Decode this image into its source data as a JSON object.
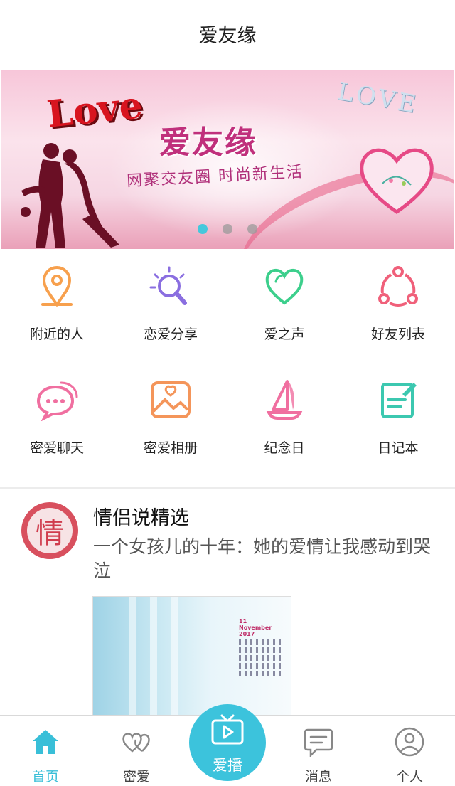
{
  "header": {
    "title": "爱友缘"
  },
  "banner": {
    "love_text": "Love",
    "love_text_2": "LOVE",
    "title": "爱友缘",
    "slogan": "网聚交友圈 时尚新生活",
    "slide_count": 3,
    "active_slide": 1
  },
  "features": [
    {
      "label": "附近的人",
      "icon": "location-pin-icon",
      "color": "#f7a04d"
    },
    {
      "label": "恋爱分享",
      "icon": "lightbulb-icon",
      "color": "#8a6ee0"
    },
    {
      "label": "爱之声",
      "icon": "heart-icon",
      "color": "#3ccf8c"
    },
    {
      "label": "好友列表",
      "icon": "share-nodes-icon",
      "color": "#f0607a"
    },
    {
      "label": "密爱聊天",
      "icon": "chat-bubble-icon",
      "color": "#f06fa0"
    },
    {
      "label": "密爱相册",
      "icon": "photo-album-icon",
      "color": "#f4955a"
    },
    {
      "label": "纪念日",
      "icon": "sailboat-icon",
      "color": "#f06fa0"
    },
    {
      "label": "日记本",
      "icon": "notebook-icon",
      "color": "#3cc8b0"
    }
  ],
  "article": {
    "avatar_char": "情",
    "section_title": "情侣说精选",
    "headline": "一个女孩儿的十年：她的爱情让我感动到哭泣",
    "calendar_month": "11 November 2017"
  },
  "tabs": [
    {
      "label": "首页",
      "icon": "home-icon",
      "active": true
    },
    {
      "label": "密爱",
      "icon": "double-heart-icon",
      "active": false
    },
    {
      "label": "爱播",
      "icon": "tv-play-icon",
      "active": false
    },
    {
      "label": "消息",
      "icon": "message-icon",
      "active": false
    },
    {
      "label": "个人",
      "icon": "person-icon",
      "active": false
    }
  ],
  "colors": {
    "accent": "#3cc3dc",
    "active_tab": "#39bfd8"
  }
}
